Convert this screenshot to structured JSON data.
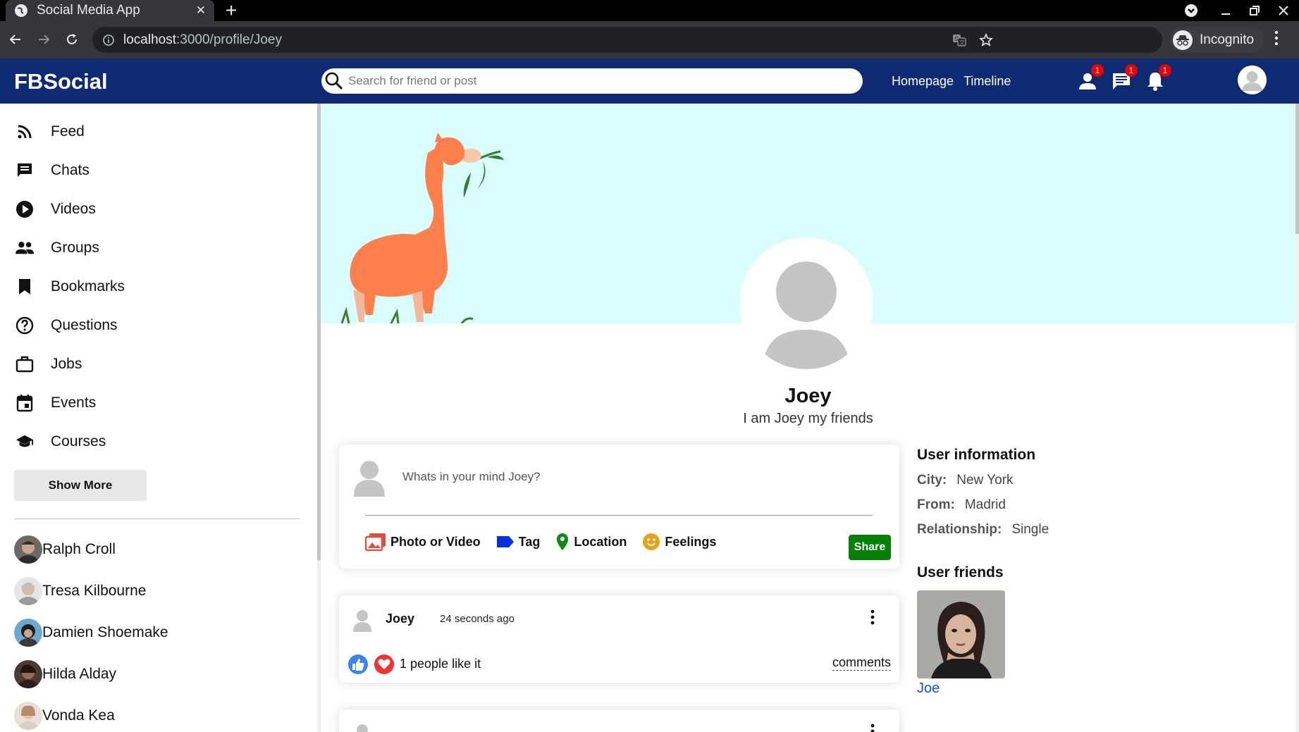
{
  "browser": {
    "tab_title": "Social Media App",
    "url_host": "localhost",
    "url_path": ":3000/profile/Joey",
    "incognito_label": "Incognito"
  },
  "header": {
    "logo": "FBSocial",
    "search_placeholder": "Search for friend or post",
    "nav_links": [
      "Homepage",
      "Timeline"
    ],
    "badges": {
      "friends": "1",
      "messages": "1",
      "notifications": "1"
    }
  },
  "sidebar": {
    "menu": [
      {
        "label": "Feed",
        "icon": "rss-feed-icon"
      },
      {
        "label": "Chats",
        "icon": "chat-icon"
      },
      {
        "label": "Videos",
        "icon": "play-circle-icon"
      },
      {
        "label": "Groups",
        "icon": "group-icon"
      },
      {
        "label": "Bookmarks",
        "icon": "bookmark-icon"
      },
      {
        "label": "Questions",
        "icon": "help-outline-icon"
      },
      {
        "label": "Jobs",
        "icon": "work-outline-icon"
      },
      {
        "label": "Events",
        "icon": "event-icon"
      },
      {
        "label": "Courses",
        "icon": "school-icon"
      }
    ],
    "show_more": "Show More",
    "friends": [
      "Ralph Croll",
      "Tresa Kilbourne",
      "Damien Shoemake",
      "Hilda Alday",
      "Vonda Kea"
    ]
  },
  "profile": {
    "name": "Joey",
    "description": "I am Joey my friends"
  },
  "share": {
    "placeholder": "Whats in your mind Joey?",
    "options": [
      "Photo or Video",
      "Tag",
      "Location",
      "Feelings"
    ],
    "button": "Share"
  },
  "post": {
    "username": "Joey",
    "time": "24 seconds ago",
    "likes": "1 people like it",
    "comments": "comments"
  },
  "user_info": {
    "title": "User information",
    "rows": [
      {
        "key": "City:",
        "value": "New York"
      },
      {
        "key": "From:",
        "value": "Madrid"
      },
      {
        "key": "Relationship:",
        "value": "Single"
      }
    ],
    "friends_title": "User friends",
    "friends": [
      "Joe"
    ]
  },
  "colors": {
    "app_header": "#0e2a72",
    "cover_bg": "#dafdfd",
    "share_button": "#058005",
    "friend_link": "#1a4fd6"
  }
}
